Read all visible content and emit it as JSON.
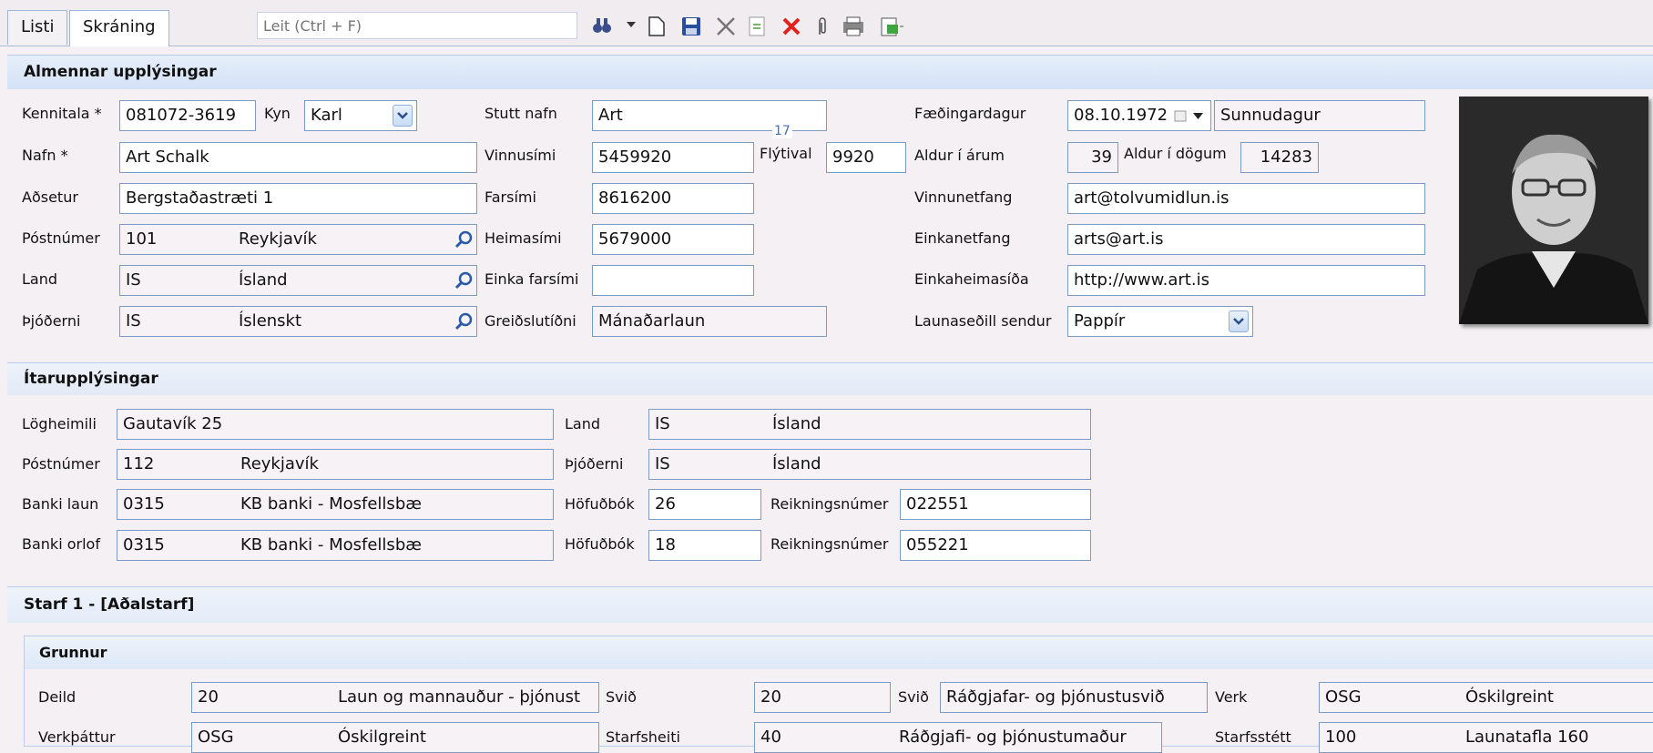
{
  "tabs": [
    {
      "label": "Listi",
      "active": false
    },
    {
      "label": "Skráning",
      "active": true
    }
  ],
  "search": {
    "placeholder": "Leit (Ctrl + F)"
  },
  "toolbar_icons": [
    "binoculars-icon",
    "dropdown-arrow-icon",
    "new-document-icon",
    "save-icon",
    "cancel-edit-icon",
    "refresh-document-icon",
    "delete-icon",
    "attachment-icon",
    "print-icon",
    "export-icon"
  ],
  "general": {
    "title": "Almennar upplýsingar",
    "kennitala": {
      "label": "Kennitala *",
      "value": "081072-3619"
    },
    "kyn": {
      "label": "Kyn",
      "value": "Karl"
    },
    "stutt_nafn": {
      "label": "Stutt nafn",
      "value": "Art"
    },
    "tooltip_marker": "17",
    "faedingardagur": {
      "label": "Fæðingardagur",
      "value": "08.10.1972",
      "weekday": "Sunnudagur"
    },
    "nafn": {
      "label": "Nafn *",
      "value": "Art Schalk"
    },
    "vinnusimi": {
      "label": "Vinnusími",
      "value": "5459920"
    },
    "flytival": {
      "label": "Flýtival",
      "value": "9920"
    },
    "aldur_arum": {
      "label": "Aldur í árum",
      "value": "39"
    },
    "aldur_dogum": {
      "label": "Aldur í dögum",
      "value": "14283"
    },
    "adsetur": {
      "label": "Aðsetur",
      "value": "Bergstaðastræti 1"
    },
    "farsimi": {
      "label": "Farsími",
      "value": "8616200"
    },
    "vinnunetfang": {
      "label": "Vinnunetfang",
      "value": "art@tolvumidlun.is"
    },
    "postnumer": {
      "label": "Póstnúmer",
      "code": "101",
      "name": "Reykjavík"
    },
    "heimasimi": {
      "label": "Heimasími",
      "value": "5679000"
    },
    "einkanetfang": {
      "label": "Einkanetfang",
      "value": "arts@art.is"
    },
    "land": {
      "label": "Land",
      "code": "IS",
      "name": "Ísland"
    },
    "einka_farsimi": {
      "label": "Einka farsími",
      "value": ""
    },
    "einkaheimasida": {
      "label": "Einkaheimasíða",
      "value": "http://www.art.is"
    },
    "thjoderni": {
      "label": "Þjóðerni",
      "code": "IS",
      "name": "Íslenskt"
    },
    "greidslutidni": {
      "label": "Greiðslutíðni",
      "value": "Mánaðarlaun"
    },
    "launasedill": {
      "label": "Launaseðill sendur",
      "value": "Pappír"
    }
  },
  "extra": {
    "title": "Ítarupplýsingar",
    "logheimili": {
      "label": "Lögheimili",
      "value": "Gautavík 25"
    },
    "land": {
      "label": "Land",
      "code": "IS",
      "name": "Ísland"
    },
    "postnumer": {
      "label": "Póstnúmer",
      "code": "112",
      "name": "Reykjavík"
    },
    "thjoderni": {
      "label": "Þjóðerni",
      "code": "IS",
      "name": "Ísland"
    },
    "banki_laun": {
      "label": "Banki laun",
      "code": "0315",
      "name": "KB banki - Mosfellsbæ"
    },
    "hofudbok1": {
      "label": "Höfuðbók",
      "value": "26"
    },
    "reikningsnumer1": {
      "label": "Reikningsnúmer",
      "value": "022551"
    },
    "banki_orlof": {
      "label": "Banki orlof",
      "code": "0315",
      "name": "KB banki - Mosfellsbæ"
    },
    "hofudbok2": {
      "label": "Höfuðbók",
      "value": "18"
    },
    "reikningsnumer2": {
      "label": "Reikningsnúmer",
      "value": "055221"
    }
  },
  "job": {
    "title": "Starf 1 - [Aðalstarf]",
    "group_title": "Grunnur",
    "deild": {
      "label": "Deild",
      "code": "20",
      "name": "Laun og mannauður - þjónust"
    },
    "svid": {
      "label": "Svið",
      "value": "20"
    },
    "svid_name": {
      "label": "Svið",
      "value": "Ráðgjafar- og þjónustusvið"
    },
    "verk": {
      "label": "Verk",
      "code": "OSG",
      "name": "Óskilgreint"
    },
    "verkthattur": {
      "label": "Verkþáttur",
      "code": "OSG",
      "name": "Óskilgreint"
    },
    "starfsheiti": {
      "label": "Starfsheiti",
      "value": "40"
    },
    "starfsheiti_name": {
      "value": "Ráðgjafi- og þjónustumaður"
    },
    "starfsstett": {
      "label": "Starfsstétt",
      "code": "100",
      "name": "Launatafla 160"
    }
  },
  "colors": {
    "accent": "#7a9cc4",
    "header_bg": "#d8e4f6",
    "page_bg": "#f4f0f4"
  }
}
